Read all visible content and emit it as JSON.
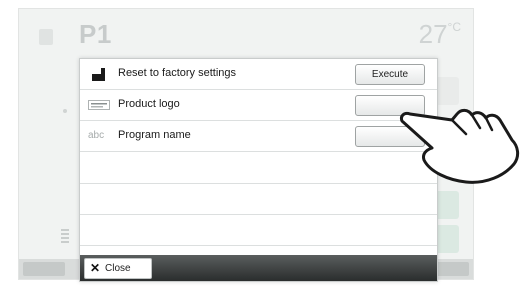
{
  "background": {
    "title": "P1",
    "temperature": "27",
    "temperature_unit": "°C"
  },
  "dialog": {
    "rows": [
      {
        "label": "Reset to factory settings",
        "icon": "reset-icon",
        "button": "Execute"
      },
      {
        "label": "Product logo",
        "icon": "logo-icon",
        "button": ""
      },
      {
        "label": "Program name",
        "icon": "abc-text-icon",
        "icon_text": "abc",
        "button": ""
      }
    ],
    "close_label": "Close"
  },
  "colors": {
    "dialog_bar": "#3a3d3d",
    "background_panel": "#f1f3f2",
    "side_buttons": "#dbe9e2"
  }
}
